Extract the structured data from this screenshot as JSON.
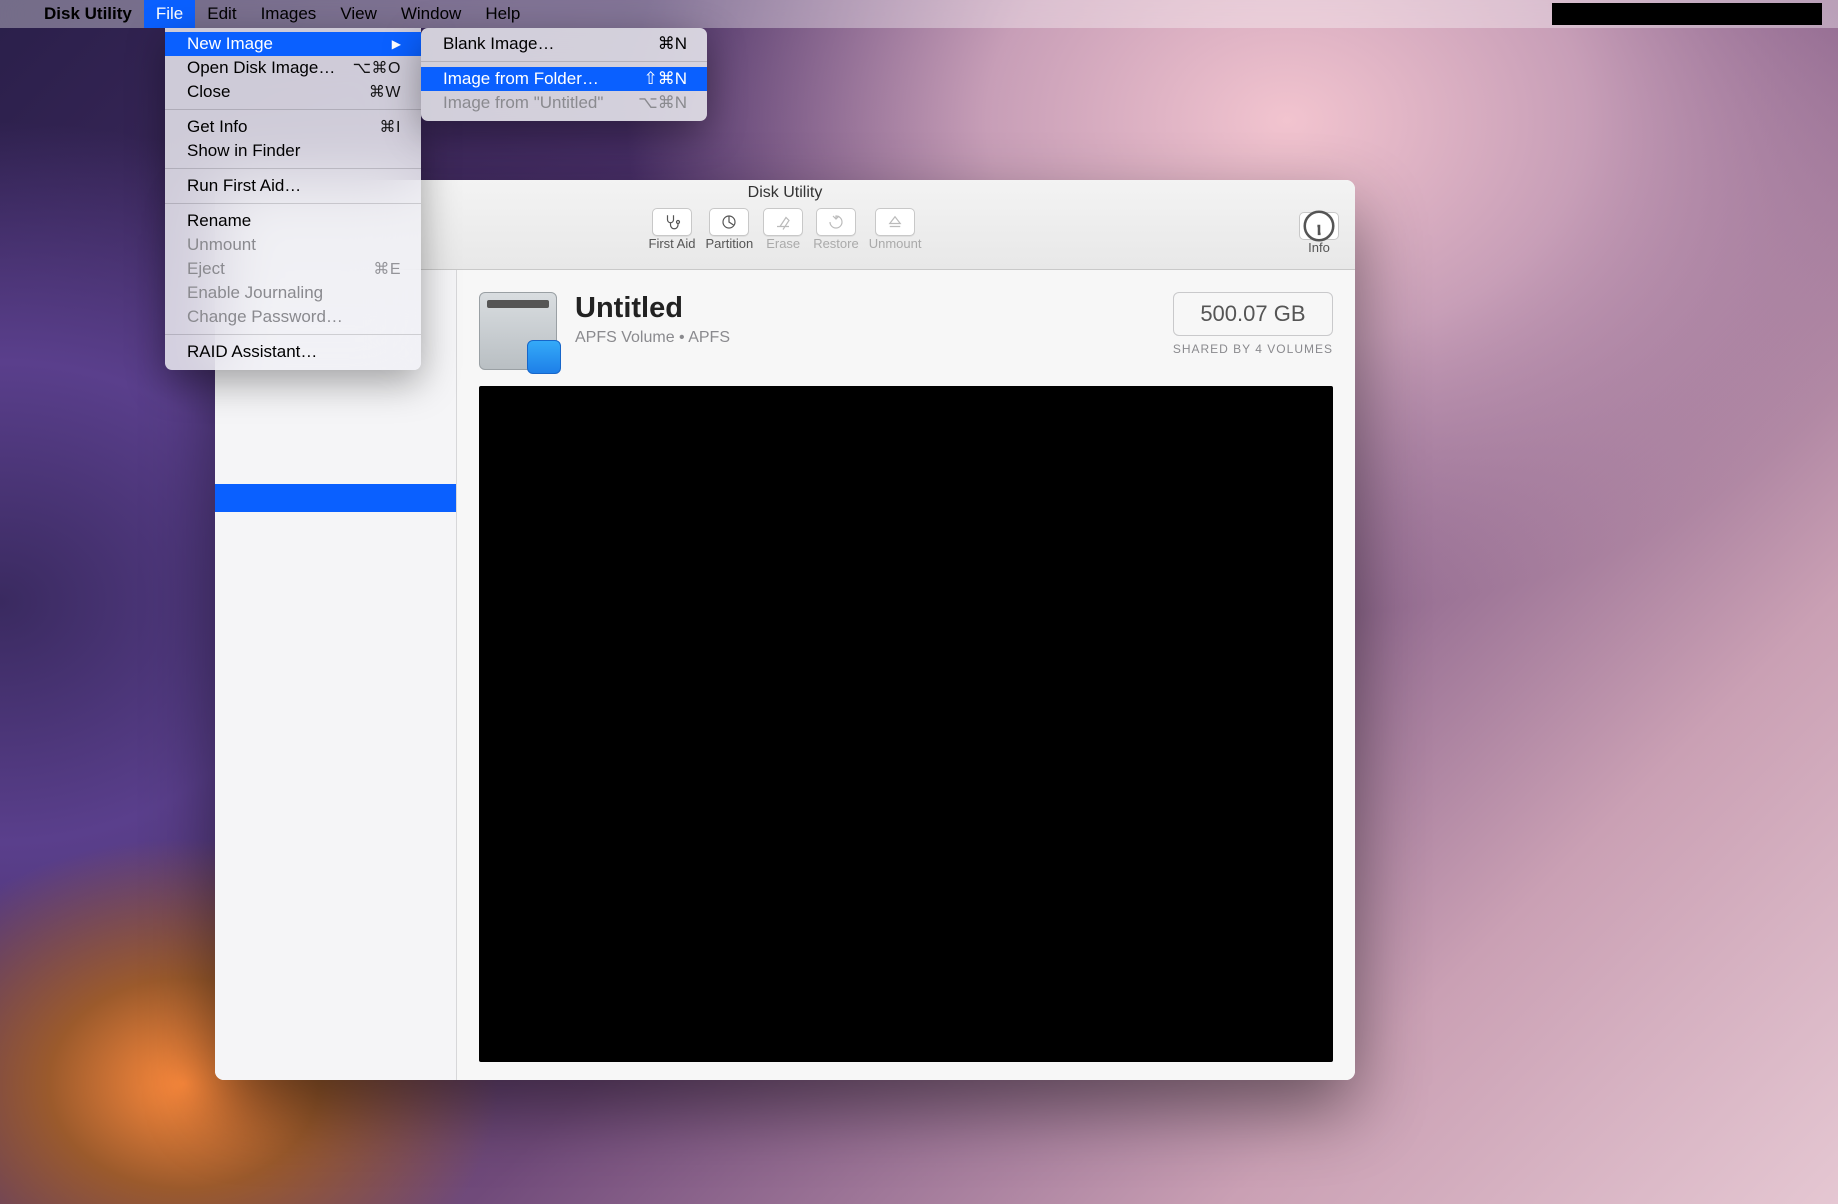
{
  "menubar": {
    "app_name": "Disk Utility",
    "items": [
      "File",
      "Edit",
      "Images",
      "View",
      "Window",
      "Help"
    ]
  },
  "file_menu": {
    "new_image": "New Image",
    "open_disk_image": "Open Disk Image…",
    "open_disk_image_sc": "⌥⌘O",
    "close": "Close",
    "close_sc": "⌘W",
    "get_info": "Get Info",
    "get_info_sc": "⌘I",
    "show_in_finder": "Show in Finder",
    "run_first_aid": "Run First Aid…",
    "rename": "Rename",
    "unmount": "Unmount",
    "eject": "Eject",
    "eject_sc": "⌘E",
    "enable_journaling": "Enable Journaling",
    "change_password": "Change Password…",
    "raid_assistant": "RAID Assistant…"
  },
  "new_image_submenu": {
    "blank": "Blank Image…",
    "blank_sc": "⌘N",
    "from_folder": "Image from Folder…",
    "from_folder_sc": "⇧⌘N",
    "from_untitled": "Image from \"Untitled\"",
    "from_untitled_sc": "⌥⌘N"
  },
  "window": {
    "title": "Disk Utility",
    "toolbar": {
      "first_aid": "First Aid",
      "partition": "Partition",
      "erase": "Erase",
      "restore": "Restore",
      "unmount": "Unmount",
      "info": "Info"
    },
    "volume": {
      "name": "Untitled",
      "subtitle": "APFS Volume • APFS",
      "size": "500.07 GB",
      "shared": "SHARED BY 4 VOLUMES"
    }
  }
}
